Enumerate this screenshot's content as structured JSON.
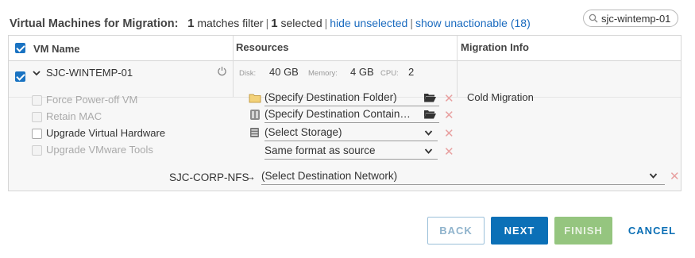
{
  "header": {
    "title": "Virtual Machines for Migration:",
    "matches_count": "1",
    "matches_label": "matches filter",
    "selected_count": "1",
    "selected_label": "selected",
    "hide_unselected": "hide unselected",
    "show_unactionable": "show unactionable (18)"
  },
  "search": {
    "value": "sjc-wintemp-01",
    "icon": "search-icon"
  },
  "columns": {
    "vm_name": "VM Name",
    "resources": "Resources",
    "migration_info": "Migration Info"
  },
  "vm": {
    "name": "SJC-WINTEMP-01",
    "selected": true,
    "disk_label": "Disk:",
    "disk_value": "40 GB",
    "memory_label": "Memory:",
    "memory_value": "4 GB",
    "cpu_label": "CPU:",
    "cpu_value": "2",
    "migration_info": "Cold Migration"
  },
  "options": [
    {
      "label": "Force Power-off VM",
      "enabled": false,
      "checked": false
    },
    {
      "label": "Retain MAC",
      "enabled": false,
      "checked": false
    },
    {
      "label": "Upgrade Virtual Hardware",
      "enabled": true,
      "checked": false
    },
    {
      "label": "Upgrade VMware Tools",
      "enabled": false,
      "checked": false
    }
  ],
  "destination": {
    "folder": "(Specify Destination Folder)",
    "container": "(Specify Destination Contain…",
    "storage": "(Select Storage)",
    "format": "Same format as source",
    "network_source": "SJC-CORP-NFS",
    "network_arrow": "→",
    "network": "(Select Destination Network)"
  },
  "buttons": {
    "back": "BACK",
    "next": "NEXT",
    "finish": "FINISH",
    "cancel": "CANCEL"
  },
  "colors": {
    "accent": "#0b70b7",
    "finish": "#95c57f",
    "link": "#1b6bbf",
    "checkbox": "#1a73c2"
  }
}
